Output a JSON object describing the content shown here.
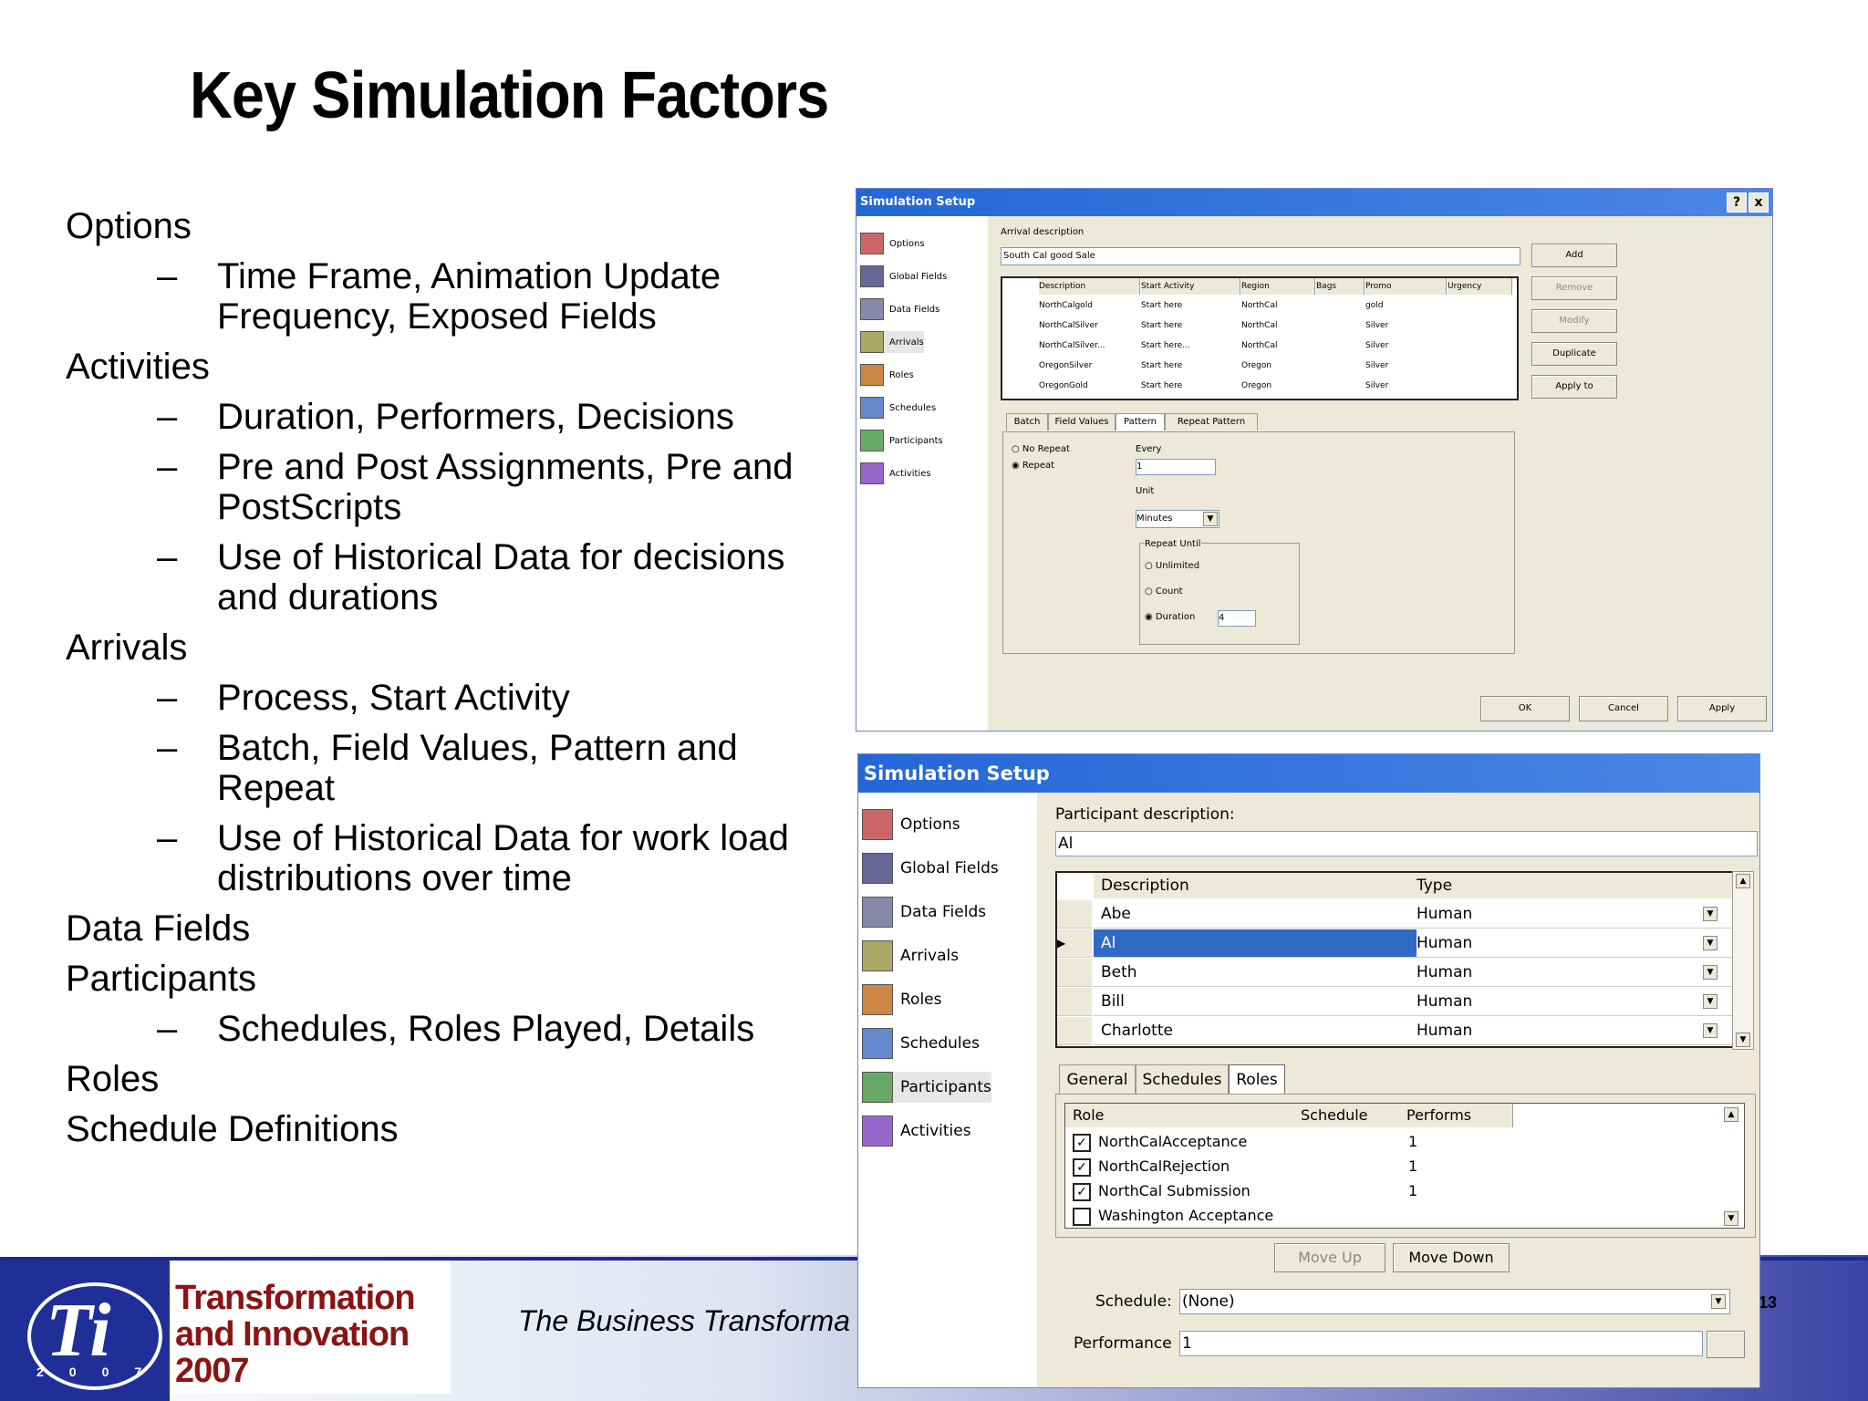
{
  "slide": {
    "title": "Key Simulation Factors",
    "bullets": [
      {
        "level": 1,
        "text": "Options"
      },
      {
        "level": 2,
        "text": "Time Frame, Animation Update Frequency, Exposed Fields"
      },
      {
        "level": 1,
        "text": "Activities"
      },
      {
        "level": 2,
        "text": "Duration, Performers, Decisions"
      },
      {
        "level": 2,
        "text": "Pre and Post Assignments, Pre and PostScripts"
      },
      {
        "level": 2,
        "text": "Use of Historical Data for decisions and durations"
      },
      {
        "level": 1,
        "text": "Arrivals"
      },
      {
        "level": 2,
        "text": "Process, Start Activity"
      },
      {
        "level": 2,
        "text": "Batch, Field Values, Pattern and Repeat"
      },
      {
        "level": 2,
        "text": "Use of Historical Data for work load distributions over time"
      },
      {
        "level": 1,
        "text": "Data Fields"
      },
      {
        "level": 1,
        "text": "Participants"
      },
      {
        "level": 2,
        "text": "Schedules, Roles Played, Details"
      },
      {
        "level": 1,
        "text": "Roles"
      },
      {
        "level": 1,
        "text": "Schedule Definitions"
      }
    ],
    "dash": "–"
  },
  "footer": {
    "logo_letters": "Ti",
    "logo_year": "2007",
    "logo_line1": "Transformation",
    "logo_line2": "and Innovation",
    "logo_line3": "2007",
    "text": "The Business Transforma",
    "page_number": "13"
  },
  "dialog1": {
    "title": "Simulation Setup",
    "help_btn": "?",
    "close_btn": "x",
    "nav": [
      "Options",
      "Global Fields",
      "Data Fields",
      "Arrivals",
      "Roles",
      "Schedules",
      "Participants",
      "Activities"
    ],
    "arrival_desc_label": "Arrival description",
    "arrival_desc_value": "South Cal good Sale",
    "grid_headers": [
      "Description",
      "Start Activity",
      "Region",
      "Bags",
      "Promo",
      "Urgency"
    ],
    "grid_rows": [
      [
        "NorthCalgold",
        "Start here",
        "NorthCal",
        "",
        "gold",
        ""
      ],
      [
        "NorthCalSilver",
        "Start here",
        "NorthCal",
        "",
        "Silver",
        ""
      ],
      [
        "NorthCalSilver...",
        "Start here...",
        "NorthCal",
        "",
        "Silver",
        ""
      ],
      [
        "OregonSilver",
        "Start here",
        "Oregon",
        "",
        "Silver",
        ""
      ],
      [
        "OregonGold",
        "Start here",
        "Oregon",
        "",
        "Silver",
        ""
      ]
    ],
    "side_buttons": [
      "Add",
      "Remove",
      "Modify",
      "Duplicate",
      "Apply to"
    ],
    "tabs": [
      "Batch",
      "Field Values",
      "Pattern",
      "Repeat Pattern"
    ],
    "radio_no_repeat": "No Repeat",
    "radio_repeat": "Repeat",
    "every_label": "Every",
    "every_value": "1",
    "unit_label": "Unit",
    "unit_value": "Minutes",
    "repeat_until_label": "Repeat Until",
    "until_unlimited": "Unlimited",
    "until_count": "Count",
    "until_duration": "Duration",
    "duration_value": "4",
    "bottom_buttons": [
      "OK",
      "Cancel",
      "Apply"
    ]
  },
  "dialog2": {
    "title": "Simulation Setup",
    "nav": [
      "Options",
      "Global Fields",
      "Data Fields",
      "Arrivals",
      "Roles",
      "Schedules",
      "Participants",
      "Activities"
    ],
    "participant_desc_label": "Participant description:",
    "participant_desc_value": "Al",
    "grid_headers": [
      "Description",
      "Type"
    ],
    "grid_rows": [
      {
        "desc": "Abe",
        "type": "Human",
        "selected": false,
        "pointer": ""
      },
      {
        "desc": "Al",
        "type": "Human",
        "selected": true,
        "pointer": "▶"
      },
      {
        "desc": "Beth",
        "type": "Human",
        "selected": false,
        "pointer": ""
      },
      {
        "desc": "Bill",
        "type": "Human",
        "selected": false,
        "pointer": ""
      },
      {
        "desc": "Charlotte",
        "type": "Human",
        "selected": false,
        "pointer": ""
      }
    ],
    "tabs": [
      "General",
      "Schedules",
      "Roles"
    ],
    "roles_headers": [
      "Role",
      "Schedule",
      "Performs"
    ],
    "roles_rows": [
      {
        "role": "NorthCalAcceptance",
        "performs": "1",
        "checked": true
      },
      {
        "role": "NorthCalRejection",
        "performs": "1",
        "checked": true
      },
      {
        "role": "NorthCal Submission",
        "performs": "1",
        "checked": true
      },
      {
        "role": "Washington Acceptance",
        "performs": "",
        "checked": false
      }
    ],
    "move_up": "Move Up",
    "move_down": "Move Down",
    "schedule_label": "Schedule:",
    "schedule_value": "(None)",
    "performance_label": "Performance",
    "performance_value": "1"
  }
}
